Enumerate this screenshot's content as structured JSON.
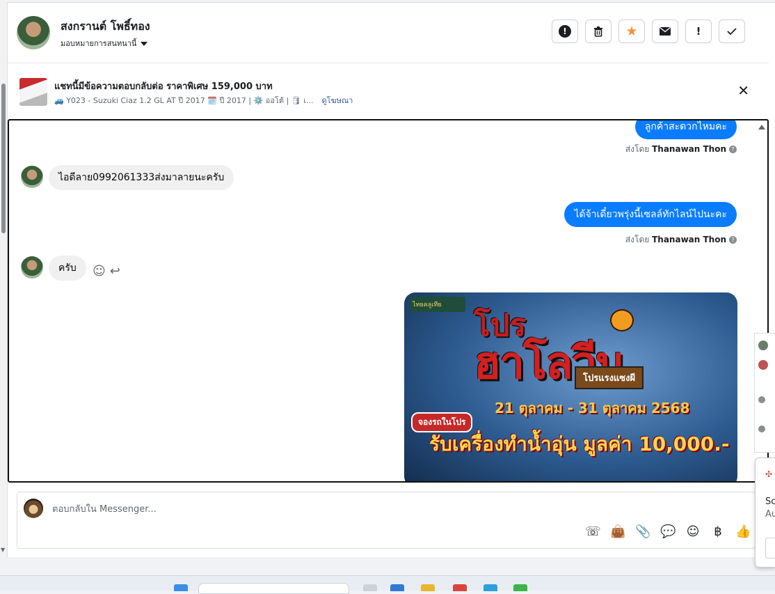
{
  "header": {
    "name": "สงกรานต์ โพธิ์ทอง",
    "assign_label": "มอบหมายการสนทนานี้",
    "toolbar": [
      {
        "name": "report-icon",
        "glyph": "❗"
      },
      {
        "name": "trash-icon",
        "glyph": "🗑"
      },
      {
        "name": "star-icon",
        "glyph": "★"
      },
      {
        "name": "mail-icon",
        "glyph": "✉"
      },
      {
        "name": "exclamation-icon",
        "glyph": "!"
      },
      {
        "name": "check-icon",
        "glyph": "✓"
      }
    ]
  },
  "ad": {
    "title": "แชทนี้มีข้อความตอบกลับต่อ ราคาพิเศษ 159,000 บาท",
    "details": "🚙 Y023 - Suzuki Ciaz 1.2 GL AT ปี 2017 🗓️ ปี 2017 | ⚙️ ออโต้ | 🛢 เ...",
    "link": "ดูโฆษณา",
    "close": "✕"
  },
  "messages": {
    "out1": "ลูกค้าสะดวกไหมคะ",
    "sent_by_prefix": "ส่งโดย",
    "sender": "Thanawan Thon",
    "in1": "ไอดีลาย0992061333ส่งมาลายนะครับ",
    "out2": "ได้จ้าเดี๋ยวพรุ่งนี้เซลล์ทักไลน์ไปนะคะ",
    "in2": "ครับ",
    "react": "☺",
    "reply": "↩"
  },
  "promo": {
    "logo": "ไทยคลูเทีย",
    "title1": "โปร",
    "title2": "ฮาโลวีน",
    "tag": "โปรแรงแซงผี",
    "dates": "21 ตุลาคม - 31 ตุลาคม 2568",
    "badge": "จองรถในโปร",
    "offer": "รับเครื่องทำน้ำอุ่น มูลค่า 10,000.-"
  },
  "composer": {
    "placeholder": "ตอบกลับใน Messenger..."
  },
  "composer_tools": {
    "call": "☏",
    "bag": "👜",
    "attach": "📎",
    "chat": "💬",
    "emoji": "☺",
    "baht": "฿",
    "like": "👍"
  },
  "side_popup": {
    "line1": "Sc",
    "line2": "Au"
  }
}
